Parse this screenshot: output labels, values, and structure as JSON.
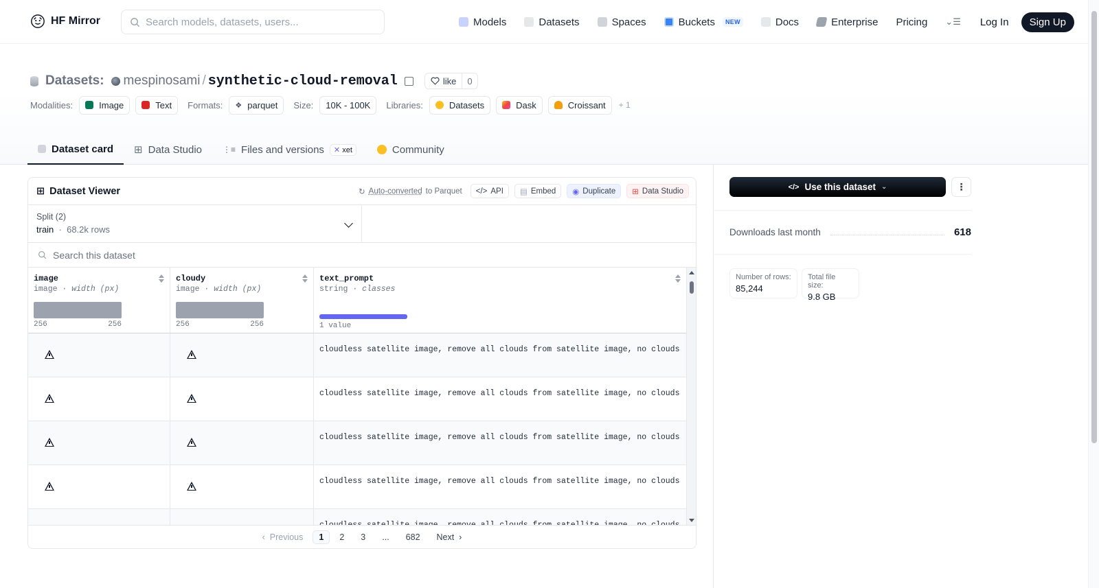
{
  "nav": {
    "brand": "HF Mirror",
    "search_placeholder": "Search models, datasets, users...",
    "links": [
      "Models",
      "Datasets",
      "Spaces",
      "Buckets",
      "Docs",
      "Enterprise",
      "Pricing"
    ],
    "buckets_badge": "NEW",
    "login": "Log In",
    "signup": "Sign Up"
  },
  "header": {
    "prefix": "Datasets:",
    "owner": "mespinosami",
    "name": "synthetic-cloud-removal",
    "like_label": "like",
    "like_count": "0"
  },
  "meta": {
    "modalities_label": "Modalities:",
    "modalities": [
      "Image",
      "Text"
    ],
    "formats_label": "Formats:",
    "format": "parquet",
    "size_label": "Size:",
    "size": "10K - 100K",
    "libraries_label": "Libraries:",
    "libraries": [
      "Datasets",
      "Dask",
      "Croissant"
    ],
    "libraries_more": "+ 1"
  },
  "tabs": [
    "Dataset card",
    "Data Studio",
    "Files and versions",
    "Community"
  ],
  "tabs_xet": "xet",
  "viewer": {
    "title": "Dataset Viewer",
    "autoconv_link": "Auto-converted",
    "autoconv_rest": "to Parquet",
    "api": "API",
    "embed": "Embed",
    "duplicate": "Duplicate",
    "data_studio": "Data Studio",
    "split_label": "Split (2)",
    "split_value": "train",
    "split_rows": "68.2k rows",
    "search_placeholder": "Search this dataset",
    "columns": [
      {
        "name": "image",
        "type": "image",
        "stat": "width (px)",
        "min": "256",
        "max": "256"
      },
      {
        "name": "cloudy",
        "type": "image",
        "stat": "width (px)",
        "min": "256",
        "max": "256"
      },
      {
        "name": "text_prompt",
        "type": "string",
        "stat": "classes",
        "summary": "1 value"
      }
    ],
    "row_text": "cloudless satellite image, remove all clouds from satellite image, no clouds",
    "pager": {
      "prev": "Previous",
      "pages": [
        "1",
        "2",
        "3",
        "...",
        "682"
      ],
      "next": "Next"
    }
  },
  "sidebar": {
    "use_button": "Use this dataset",
    "downloads_label": "Downloads last month",
    "downloads_value": "618",
    "rows_label": "Number of rows:",
    "rows_value": "85,244",
    "size_label": "Total file size:",
    "size_value": "9.8 GB"
  }
}
